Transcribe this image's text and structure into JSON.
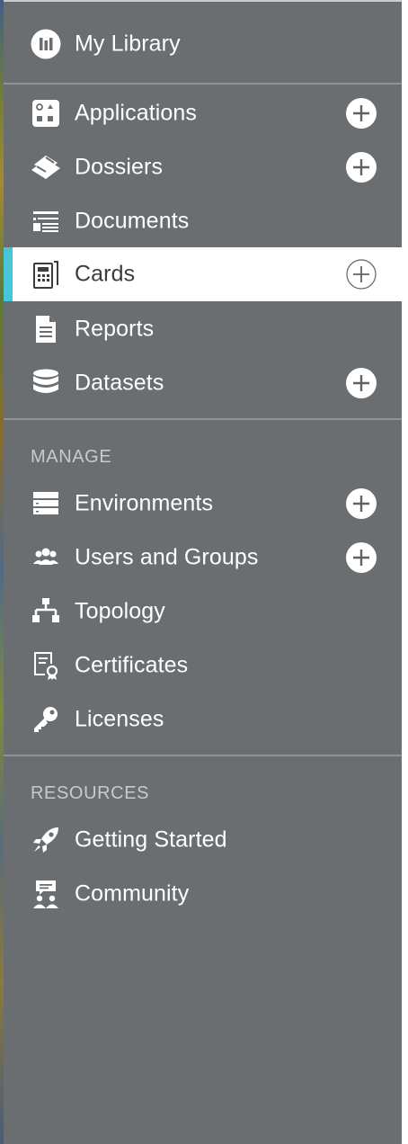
{
  "nav": {
    "top_item": {
      "label": "My Library",
      "icon": "library-icon"
    },
    "primary_items": [
      {
        "label": "Applications",
        "icon": "applications-icon",
        "has_add": true
      },
      {
        "label": "Dossiers",
        "icon": "dossiers-icon",
        "has_add": true
      },
      {
        "label": "Documents",
        "icon": "documents-icon",
        "has_add": false
      },
      {
        "label": "Cards",
        "icon": "cards-icon",
        "has_add": true,
        "active": true
      },
      {
        "label": "Reports",
        "icon": "reports-icon",
        "has_add": false
      },
      {
        "label": "Datasets",
        "icon": "datasets-icon",
        "has_add": true
      }
    ],
    "manage": {
      "heading": "MANAGE",
      "items": [
        {
          "label": "Environments",
          "icon": "environments-icon",
          "has_add": true
        },
        {
          "label": "Users and Groups",
          "icon": "users-icon",
          "has_add": true
        },
        {
          "label": "Topology",
          "icon": "topology-icon",
          "has_add": false
        },
        {
          "label": "Certificates",
          "icon": "certificate-icon",
          "has_add": false
        },
        {
          "label": "Licenses",
          "icon": "key-icon",
          "has_add": false
        }
      ]
    },
    "resources": {
      "heading": "RESOURCES",
      "items": [
        {
          "label": "Getting Started",
          "icon": "rocket-icon"
        },
        {
          "label": "Community",
          "icon": "community-icon"
        }
      ]
    }
  },
  "colors": {
    "sidebar_bg": "#6a6e71",
    "active_bg": "#ffffff",
    "active_accent": "#48c6d9",
    "text": "#ffffff",
    "section_heading": "#c8cacc"
  }
}
